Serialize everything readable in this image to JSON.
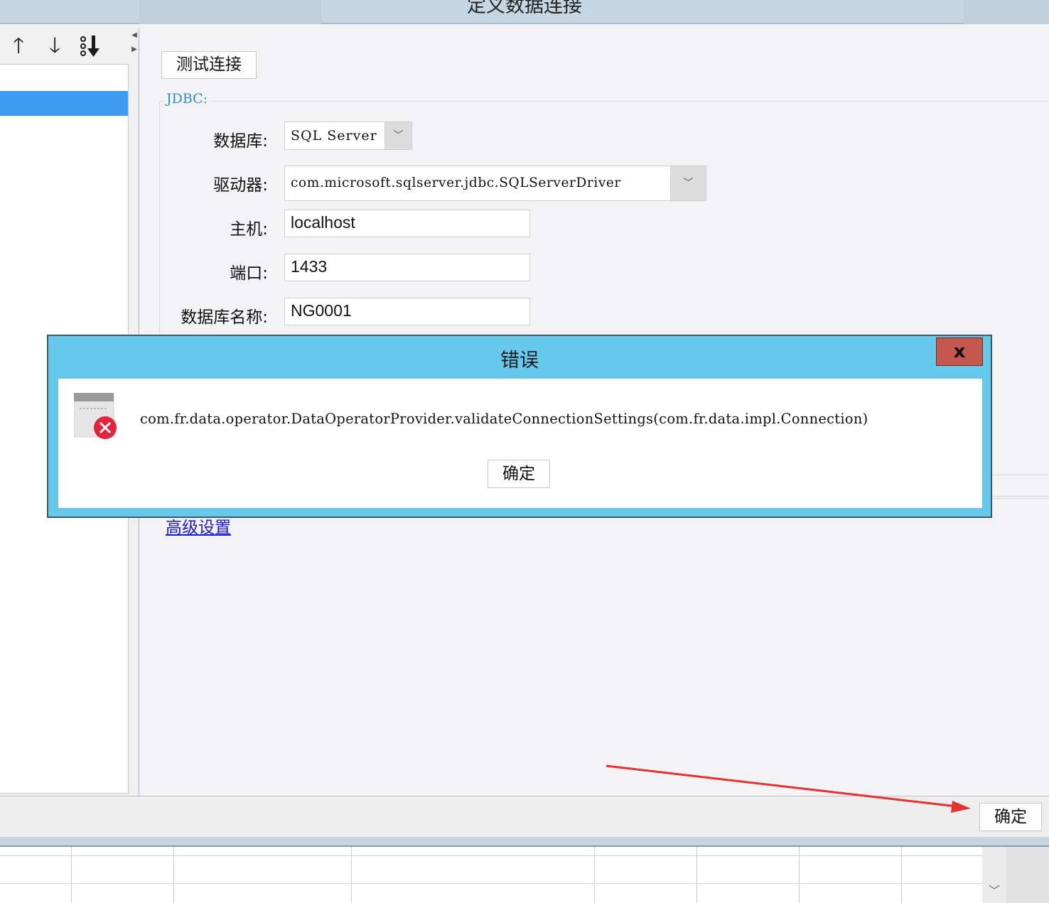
{
  "window": {
    "title": "定义数据连接"
  },
  "toolbar": {
    "move_up_icon": "arrow-up-icon",
    "move_down_icon": "arrow-down-icon",
    "sort_icon": "sort-icon",
    "collapse_icon": "collapse-arrows-icon"
  },
  "main": {
    "test_connection_label": "测试连接",
    "group_legend": "JDBC:",
    "database_label": "数据库:",
    "database_value": "SQL Server",
    "driver_label": "驱动器:",
    "driver_value": "com.microsoft.sqlserver.jdbc.SQLServerDriver",
    "host_label": "主机:",
    "host_value": "localhost",
    "port_label": "端口:",
    "port_value": "1433",
    "dbname_label": "数据库名称:",
    "dbname_value": "NG0001",
    "advanced_link": "高级设置"
  },
  "footer": {
    "ok_label": "确定"
  },
  "error_dialog": {
    "title": "错误",
    "close_label": "x",
    "icon": "error-icon",
    "message": "com.fr.data.operator.DataOperatorProvider.validateConnectionSettings(com.fr.data.impl.Connection)",
    "ok_label": "确定"
  },
  "colors": {
    "selection": "#3d9cf0",
    "dialog_frame": "#66c8ea",
    "close_button": "#c5574e",
    "annotation_arrow": "#e8312f",
    "link": "#1a1ad8"
  }
}
